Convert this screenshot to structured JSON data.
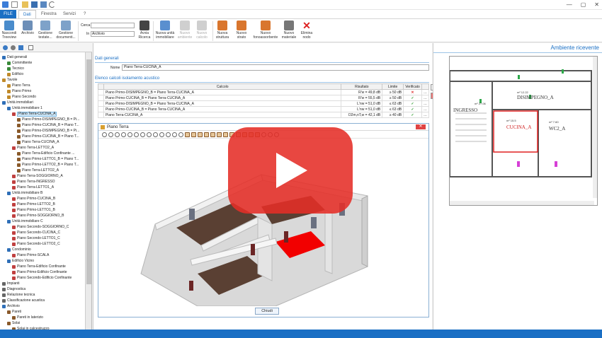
{
  "menu": {
    "file": "FILE",
    "tabs": [
      "Dati",
      "Finestra",
      "Servizi",
      "?"
    ]
  },
  "ribbon": {
    "buttons": [
      {
        "label": "Nascondi\nTreeview",
        "dis": false
      },
      {
        "label": "Archivio",
        "dis": false
      },
      {
        "label": "Gestione\ntestate...",
        "dis": false
      },
      {
        "label": "Gestione\ndocumenti...",
        "dis": false
      }
    ],
    "cerca_label": "Cerca",
    "in_label": "In",
    "in_value": "Archivio",
    "buttons2": [
      {
        "label": "Avvia\nRicerca",
        "dis": false
      },
      {
        "label": "Nuova unità\nimmobiliare",
        "dis": false
      },
      {
        "label": "Nuovo\nambiente",
        "dis": true
      },
      {
        "label": "Nuovo\ncalcolo",
        "dis": true
      },
      {
        "label": "Nuova\nstruttura",
        "dis": false
      },
      {
        "label": "Nuovo\nstrato",
        "dis": false
      },
      {
        "label": "Nuovo\nfonoassorbente",
        "dis": false
      },
      {
        "label": "Nuovo\nmateriale",
        "dis": false
      },
      {
        "label": "Elimina\nnodo",
        "dis": false
      }
    ]
  },
  "tree": [
    {
      "d": 0,
      "t": "Dati generali",
      "c": "#2f6fb8"
    },
    {
      "d": 1,
      "t": "Committente",
      "c": "#3a8a3a"
    },
    {
      "d": 1,
      "t": "Tecnico",
      "c": "#3a8a3a"
    },
    {
      "d": 1,
      "t": "Edificio",
      "c": "#c08a2a"
    },
    {
      "d": 0,
      "t": "Tavole",
      "c": "#c08a2a"
    },
    {
      "d": 1,
      "t": "Piano Terra",
      "c": "#c08a2a"
    },
    {
      "d": 1,
      "t": "Piano  Primo",
      "c": "#c08a2a"
    },
    {
      "d": 1,
      "t": "Piano Secondo",
      "c": "#c08a2a"
    },
    {
      "d": 0,
      "t": "Unità immobiliari",
      "c": "#2f6fb8"
    },
    {
      "d": 1,
      "t": "Unità immobiliare 1",
      "c": "#2f6fb8"
    },
    {
      "d": 2,
      "t": "Piano Terra-CUCINA_A",
      "c": "#c04040",
      "sel": true
    },
    {
      "d": 3,
      "t": "Piano  Primo-DISIMPEGNO_B = Pi...",
      "c": "#8a5a2b"
    },
    {
      "d": 3,
      "t": "Piano  Primo-CUCINA_B = Piano T...",
      "c": "#8a5a2b"
    },
    {
      "d": 3,
      "t": "Piano  Primo-DISIMPEGNO_B = Pi...",
      "c": "#8a5a2b"
    },
    {
      "d": 3,
      "t": "Piano  Primo-CUCINA_B = Piano T...",
      "c": "#8a5a2b"
    },
    {
      "d": 3,
      "t": "Piano Terra-CUCINA_A",
      "c": "#8a5a2b"
    },
    {
      "d": 2,
      "t": "Piano Terra-LETTO2_A",
      "c": "#c04040"
    },
    {
      "d": 3,
      "t": "Piano Terra-Edificio Confinante ...",
      "c": "#8a5a2b"
    },
    {
      "d": 3,
      "t": "Piano  Primo-LETTO1_B = Piano T...",
      "c": "#8a5a2b"
    },
    {
      "d": 3,
      "t": "Piano  Primo-LETTO2_B = Piano T...",
      "c": "#8a5a2b"
    },
    {
      "d": 3,
      "t": "Piano Terra-LETTO2_A",
      "c": "#8a5a2b"
    },
    {
      "d": 2,
      "t": "Piano Terra-SOGGIORNO_A",
      "c": "#c04040"
    },
    {
      "d": 2,
      "t": "Piano Terra-INGRESSO",
      "c": "#c04040"
    },
    {
      "d": 2,
      "t": "Piano Terra-LETTO1_A",
      "c": "#c04040"
    },
    {
      "d": 1,
      "t": "Unità immobiliare B",
      "c": "#2f6fb8"
    },
    {
      "d": 2,
      "t": "Piano  Primo-CUCINA_B",
      "c": "#c04040"
    },
    {
      "d": 2,
      "t": "Piano  Primo-LETTO2_B",
      "c": "#c04040"
    },
    {
      "d": 2,
      "t": "Piano  Primo-LETTO1_B",
      "c": "#c04040"
    },
    {
      "d": 2,
      "t": "Piano  Primo-SOGGIORNO_B",
      "c": "#c04040"
    },
    {
      "d": 1,
      "t": "Unità immobiliare C",
      "c": "#2f6fb8"
    },
    {
      "d": 2,
      "t": "Piano Secondo-SOGGIORNO_C",
      "c": "#c04040"
    },
    {
      "d": 2,
      "t": "Piano Secondo-CUCINA_C",
      "c": "#c04040"
    },
    {
      "d": 2,
      "t": "Piano Secondo-LETTO1_C",
      "c": "#c04040"
    },
    {
      "d": 2,
      "t": "Piano Secondo-LETTO2_C",
      "c": "#c04040"
    },
    {
      "d": 1,
      "t": "Condominio",
      "c": "#2f6fb8"
    },
    {
      "d": 2,
      "t": "Piano  Primo-SCALA",
      "c": "#c04040"
    },
    {
      "d": 1,
      "t": "Edificio Vicino",
      "c": "#2f6fb8"
    },
    {
      "d": 2,
      "t": "Piano Terra-Edificio Confinante",
      "c": "#c04040"
    },
    {
      "d": 2,
      "t": "Piano  Primo-Edificio Confinante",
      "c": "#c04040"
    },
    {
      "d": 2,
      "t": "Piano Secondo-Edificio Confinante",
      "c": "#c04040"
    },
    {
      "d": 0,
      "t": "Impianti",
      "c": "#666"
    },
    {
      "d": 0,
      "t": "Diagnostica",
      "c": "#666"
    },
    {
      "d": 0,
      "t": "Relazione tecnica",
      "c": "#666"
    },
    {
      "d": 0,
      "t": "Classificazione acustica",
      "c": "#666"
    },
    {
      "d": 0,
      "t": "Archivio",
      "c": "#2f6fb8"
    },
    {
      "d": 1,
      "t": "Pareti",
      "c": "#8a5a2b"
    },
    {
      "d": 2,
      "t": "Pareti in laterizio",
      "c": "#8a5a2b"
    },
    {
      "d": 1,
      "t": "Solai",
      "c": "#8a5a2b"
    },
    {
      "d": 2,
      "t": "Solai in calcestruzzo",
      "c": "#8a5a2b"
    }
  ],
  "center": {
    "dati_generali": "Dati generali",
    "nome_label": "Nome",
    "nome_value": "Piano Terra-CUCINA_A",
    "elenco": "Elenco calcoli isolamento acustico",
    "columns": [
      "Calcolo",
      "Risultato",
      "Limite",
      "Verificato"
    ],
    "rows": [
      {
        "calc": "Piano  Primo-DISIMPEGNO_B = Piano Terra-CUCINA_A",
        "res": "R'w = 49,8 dB",
        "lim": "≥ 50 dB",
        "ok": false
      },
      {
        "calc": "Piano  Primo-CUCINA_B = Piano Terra-CUCINA_A",
        "res": "R'w = 55,5 dB",
        "lim": "≥ 50 dB",
        "ok": true
      },
      {
        "calc": "Piano  Primo-DISIMPEGNO_B = Piano Terra-CUCINA_A",
        "res": "L'nw = 51,0 dB",
        "lim": "≤ 63 dB",
        "ok": true
      },
      {
        "calc": "Piano  Primo-CUCINA_B = Piano Terra-CUCINA_A",
        "res": "L'nw = 51,0 dB",
        "lim": "≤ 63 dB",
        "ok": true
      },
      {
        "calc": "Piano Terra-CUCINA_A",
        "res": "D2m,nT,w = 42,1 dB",
        "lim": "≥ 40 dB",
        "ok": true
      }
    ],
    "window_title": "Piano Terra",
    "chiudi": "Chiudi"
  },
  "right": {
    "title": "Ambiente ricevente",
    "rooms": [
      "DISIMPEGNO_A",
      "CUCINA_A",
      "WC2_A",
      "INGRESSO"
    ],
    "room_areas": [
      "m² 12.22",
      "m² 27.06",
      "m² 15.5",
      "m² 7.60"
    ]
  }
}
